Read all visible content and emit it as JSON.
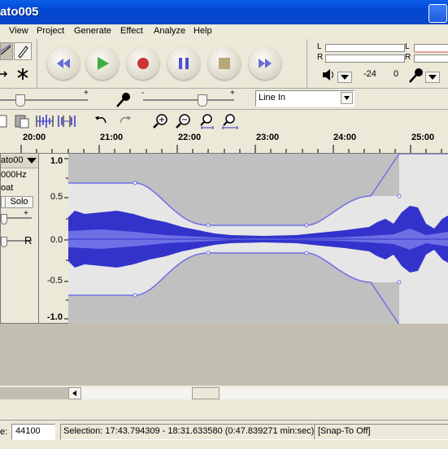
{
  "window": {
    "title": "ato005"
  },
  "menu": {
    "items": [
      "View",
      "Project",
      "Generate",
      "Effect",
      "Analyze",
      "Help"
    ]
  },
  "meters": {
    "left_label": "L",
    "right_label": "R",
    "db_low": "-24",
    "db_zero": "0"
  },
  "mixer": {
    "input_source": "Line In"
  },
  "ruler": {
    "labels": [
      "20:00",
      "21:00",
      "22:00",
      "23:00",
      "24:00",
      "25:00"
    ]
  },
  "track": {
    "name": "ato00",
    "rate": "000Hz",
    "format": "oat",
    "solo_label": "Solo",
    "pan_right_label": "R",
    "gain_plus": "+",
    "vscale": [
      "1.0",
      "0.5",
      "0.0",
      "-0.5",
      "-1.0"
    ]
  },
  "status": {
    "rate_label": "e:",
    "rate_value": "44100",
    "selection_text": "Selection: 17:43.794309 - 18:31.633580 (0:47.839271 min:sec)",
    "snap_text": "[Snap-To Off]"
  },
  "colors": {
    "waveform": "#3333cc",
    "waveform_light": "#6f6fe6",
    "envelope": "#6f6fe6",
    "track_bg": "#c0c0c0",
    "title_bar": "#0348d4"
  }
}
